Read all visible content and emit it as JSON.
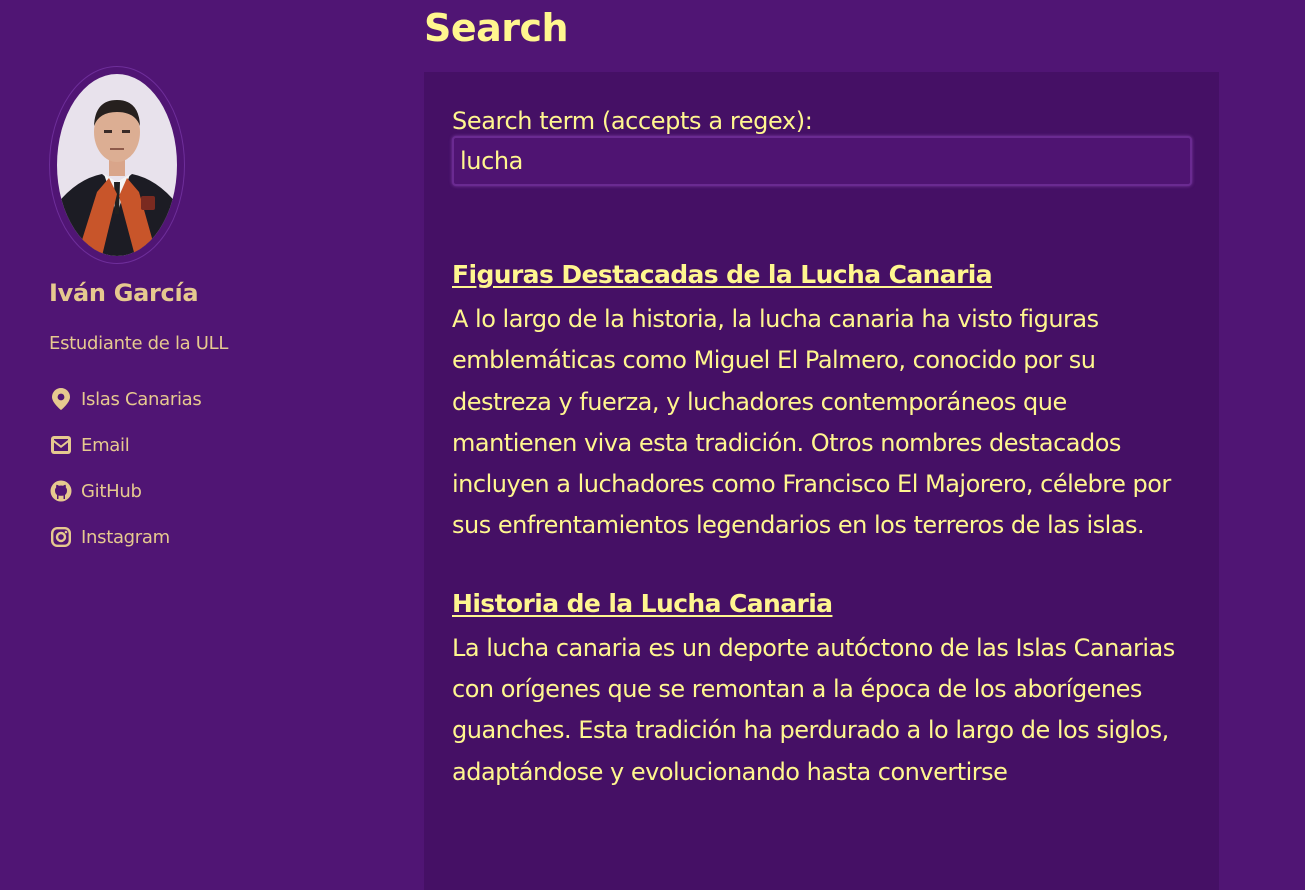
{
  "page": {
    "title": "Search"
  },
  "author": {
    "name": "Iván García",
    "bio": "Estudiante de la ULL",
    "links": [
      {
        "label": "Islas Canarias",
        "icon": "map-marker-icon"
      },
      {
        "label": "Email",
        "icon": "envelope-icon"
      },
      {
        "label": "GitHub",
        "icon": "github-icon"
      },
      {
        "label": "Instagram",
        "icon": "instagram-icon"
      }
    ]
  },
  "search": {
    "label": "Search term (accepts a regex):",
    "value": "lucha"
  },
  "results": [
    {
      "title": "Figuras Destacadas de la Lucha Canaria",
      "excerpt": "A lo largo de la historia, la lucha canaria ha visto figuras emblemáticas como Miguel El Palmero, conocido por su destreza y fuerza, y luchadores contemporáneos que mantienen viva esta tradición. Otros nombres destacados incluyen a luchadores como Francisco El Majorero, célebre por sus enfrentamientos legendarios en los terreros de las islas."
    },
    {
      "title": "Historia de la Lucha Canaria",
      "excerpt": "La lucha canaria es un deporte autóctono de las Islas Canarias con orígenes que se remontan a la época de los aborígenes guanches. Esta tradición ha perdurado a lo largo de los siglos, adaptándose y evolucionando hasta convertirse"
    }
  ],
  "colors": {
    "background": "#501574",
    "panel": "#451065",
    "accent_text": "#fff68f",
    "sidebar_text": "#e6c98f"
  }
}
